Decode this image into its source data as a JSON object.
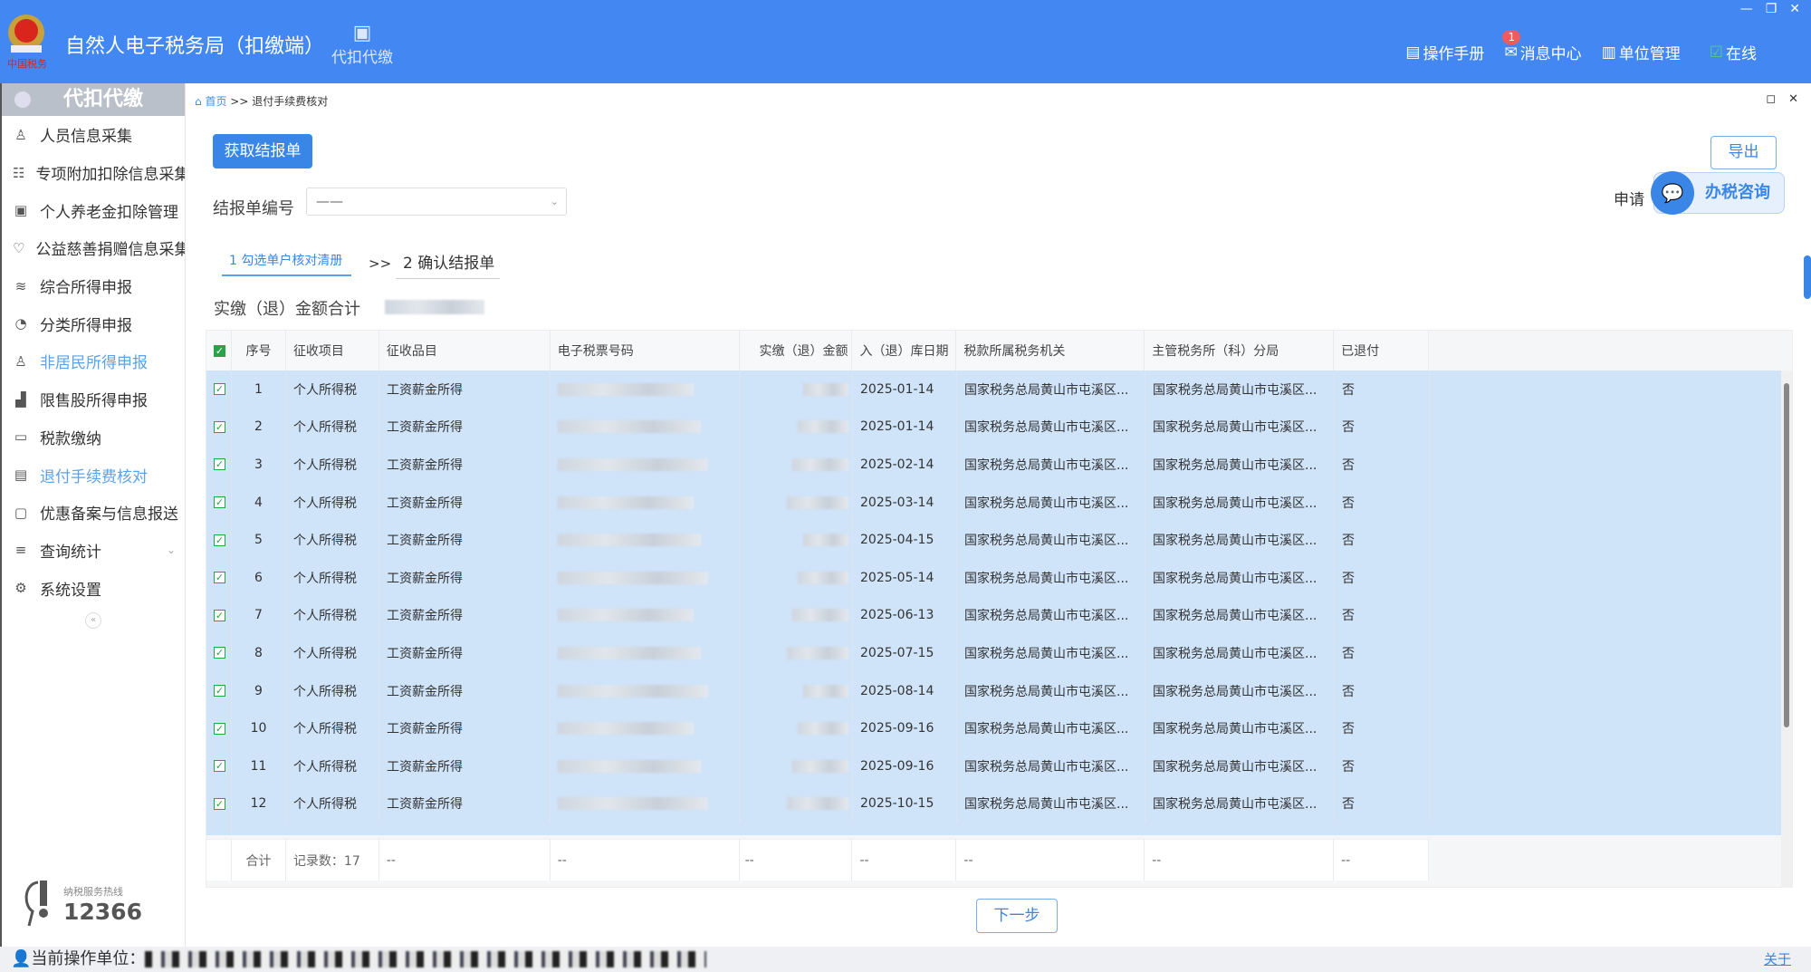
{
  "header": {
    "title": "自然人电子税务局（扣缴端）",
    "module": "代扣代缴",
    "links": [
      "操作手册",
      "消息中心",
      "单位管理",
      "在线"
    ],
    "message_badge": "1",
    "accent": "#4287f2"
  },
  "sidebar": {
    "title": "代扣代缴",
    "items": [
      {
        "label": "人员信息采集",
        "icon": "user-icon"
      },
      {
        "label": "专项附加扣除信息采集",
        "icon": "list-icon"
      },
      {
        "label": "个人养老金扣除管理",
        "icon": "pension-icon"
      },
      {
        "label": "公益慈善捐赠信息采集",
        "icon": "donate-icon"
      },
      {
        "label": "综合所得申报",
        "icon": "layers-icon"
      },
      {
        "label": "分类所得申报",
        "icon": "pie-icon"
      },
      {
        "label": "非居民所得申报",
        "icon": "person-icon",
        "active": true
      },
      {
        "label": "限售股所得申报",
        "icon": "chart-icon"
      },
      {
        "label": "税款缴纳",
        "icon": "folder-icon"
      },
      {
        "label": "退付手续费核对",
        "icon": "doc-check-icon",
        "active": true
      },
      {
        "label": "优惠备案与信息报送",
        "icon": "file-icon",
        "chevron": true
      },
      {
        "label": "查询统计",
        "icon": "search-list-icon",
        "chevron": true
      },
      {
        "label": "系统设置",
        "icon": "gear-icon"
      }
    ],
    "hotline_label": "纳税服务热线",
    "hotline": "12366"
  },
  "breadcrumb": {
    "home": "首页",
    "sep": ">>",
    "current": "退付手续费核对"
  },
  "main": {
    "fetch_button": "获取结报单",
    "export_button": "导出",
    "report_no_label": "结报单编号",
    "report_no_value": "——",
    "apply_label": "申请",
    "consult_button": "办税咨询",
    "steps": [
      {
        "label": "1 勾选单户核对清册"
      },
      {
        "label": "2 确认结报单"
      }
    ],
    "step_sep": ">>",
    "total_label": "实缴（退）金额合计",
    "next_button": "下一步"
  },
  "table": {
    "columns": [
      "序号",
      "征收项目",
      "征收品目",
      "电子税票号码",
      "实缴（退）金额",
      "入（退）库日期",
      "税款所属税务机关",
      "主管税务所（科）分局",
      "已退付"
    ],
    "rows": [
      {
        "no": "1",
        "item": "个人所得税",
        "sub": "工资薪金所得",
        "date": "2025-01-14"
      },
      {
        "no": "2",
        "item": "个人所得税",
        "sub": "工资薪金所得",
        "date": "2025-01-14"
      },
      {
        "no": "3",
        "item": "个人所得税",
        "sub": "工资薪金所得",
        "date": "2025-02-14"
      },
      {
        "no": "4",
        "item": "个人所得税",
        "sub": "工资薪金所得",
        "date": "2025-03-14"
      },
      {
        "no": "5",
        "item": "个人所得税",
        "sub": "工资薪金所得",
        "date": "2025-04-15"
      },
      {
        "no": "6",
        "item": "个人所得税",
        "sub": "工资薪金所得",
        "date": "2025-05-14"
      },
      {
        "no": "7",
        "item": "个人所得税",
        "sub": "工资薪金所得",
        "date": "2025-06-13"
      },
      {
        "no": "8",
        "item": "个人所得税",
        "sub": "工资薪金所得",
        "date": "2025-07-15"
      },
      {
        "no": "9",
        "item": "个人所得税",
        "sub": "工资薪金所得",
        "date": "2025-08-14"
      },
      {
        "no": "10",
        "item": "个人所得税",
        "sub": "工资薪金所得",
        "date": "2025-09-16"
      },
      {
        "no": "11",
        "item": "个人所得税",
        "sub": "工资薪金所得",
        "date": "2025-09-16"
      },
      {
        "no": "12",
        "item": "个人所得税",
        "sub": "工资薪金所得",
        "date": "2025-10-15"
      }
    ],
    "org": "国家税务总局黄山市屯溪区...",
    "branch": "国家税务总局黄山市屯溪区...",
    "refunded": "否",
    "footer": {
      "label": "合计",
      "count": "记录数：17",
      "empty": "--"
    }
  },
  "status": {
    "unit_label": "当前操作单位：",
    "about": "关于"
  }
}
